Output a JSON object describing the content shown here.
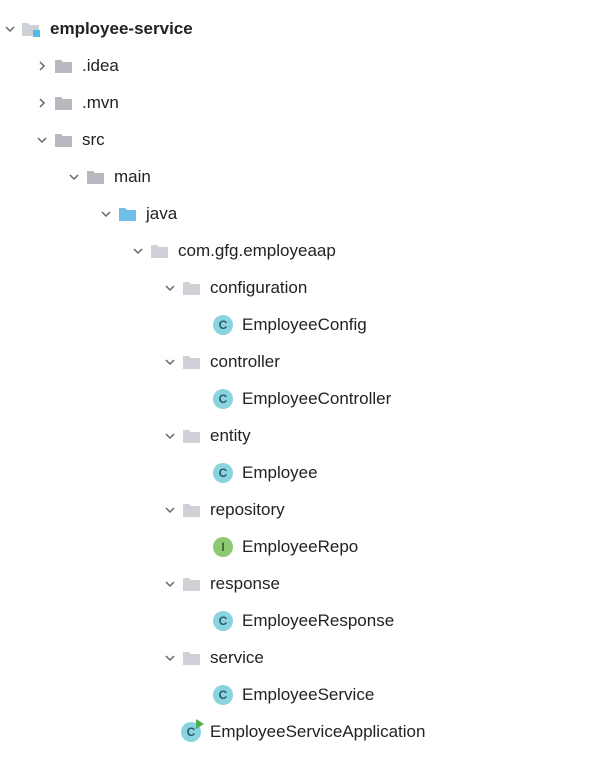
{
  "tree": {
    "root": {
      "name": "employee-service",
      "idea": ".idea",
      "mvn": ".mvn",
      "src": "src",
      "main": "main",
      "java": "java",
      "pkg": "com.gfg.employeaap",
      "configuration": "configuration",
      "employeeConfig": "EmployeeConfig",
      "controller": "controller",
      "employeeController": "EmployeeController",
      "entity": "entity",
      "employee": "Employee",
      "repository": "repository",
      "employeeRepo": "EmployeeRepo",
      "response": "response",
      "employeeResponse": "EmployeeResponse",
      "service": "service",
      "employeeService": "EmployeeService",
      "app": "EmployeeServiceApplication"
    }
  },
  "icons": {
    "class": "C",
    "interface": "I"
  }
}
